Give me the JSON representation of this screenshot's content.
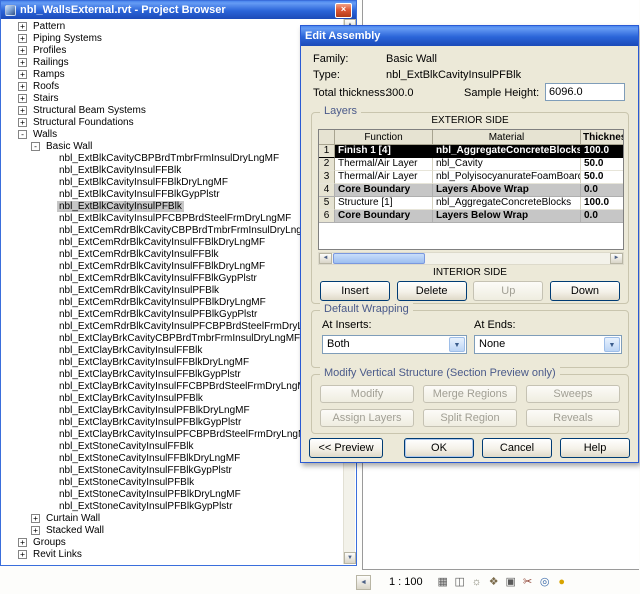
{
  "glyphs": {
    "up": "▲",
    "down": "▼",
    "left": "◄",
    "right": "►",
    "close": "×",
    "combo": "▼"
  },
  "colors": {
    "titlebar_blue": "#2A64D8",
    "dialog_bg": "#ECE9D8",
    "selected_row": "#000000",
    "core_row": "#C6C6C6",
    "tree_selection": "#C6C6C6"
  },
  "browser": {
    "title": "nbl_WallsExternal.rvt - Project Browser",
    "tree": [
      {
        "label": "Pattern",
        "level": 1,
        "exp": "+"
      },
      {
        "label": "Piping Systems",
        "level": 1,
        "exp": "+"
      },
      {
        "label": "Profiles",
        "level": 1,
        "exp": "+"
      },
      {
        "label": "Railings",
        "level": 1,
        "exp": "+"
      },
      {
        "label": "Ramps",
        "level": 1,
        "exp": "+"
      },
      {
        "label": "Roofs",
        "level": 1,
        "exp": "+"
      },
      {
        "label": "Stairs",
        "level": 1,
        "exp": "+"
      },
      {
        "label": "Structural Beam Systems",
        "level": 1,
        "exp": "+"
      },
      {
        "label": "Structural Foundations",
        "level": 1,
        "exp": "+"
      },
      {
        "label": "Walls",
        "level": 1,
        "exp": "-"
      },
      {
        "label": "Basic Wall",
        "level": 2,
        "exp": "-"
      },
      {
        "label": "nbl_ExtBlkCavityCBPBrdTmbrFrmInsulDryLngMF",
        "level": 3
      },
      {
        "label": "nbl_ExtBlkCavityInsulFFBlk",
        "level": 3
      },
      {
        "label": "nbl_ExtBlkCavityInsulFFBlkDryLngMF",
        "level": 3
      },
      {
        "label": "nbl_ExtBlkCavityInsulFFBlkGypPlstr",
        "level": 3
      },
      {
        "label": "nbl_ExtBlkCavityInsulPFBlk",
        "level": 3,
        "selected": true
      },
      {
        "label": "nbl_ExtBlkCavityInsulPFCBPBrdSteelFrmDryLngMF",
        "level": 3
      },
      {
        "label": "nbl_ExtCemRdrBlkCavityCBPBrdTmbrFrmInsulDryLngMF",
        "level": 3
      },
      {
        "label": "nbl_ExtCemRdrBlkCavityInsulFFBlkDryLngMF",
        "level": 3
      },
      {
        "label": "nbl_ExtCemRdrBlkCavityInsulFFBlk",
        "level": 3
      },
      {
        "label": "nbl_ExtCemRdrBlkCavityInsulFFBlkDryLngMF",
        "level": 3
      },
      {
        "label": "nbl_ExtCemRdrBlkCavityInsulFFBlkGypPlstr",
        "level": 3
      },
      {
        "label": "nbl_ExtCemRdrBlkCavityInsulPFBlk",
        "level": 3
      },
      {
        "label": "nbl_ExtCemRdrBlkCavityInsulPFBlkDryLngMF",
        "level": 3
      },
      {
        "label": "nbl_ExtCemRdrBlkCavityInsulPFBlkGypPlstr",
        "level": 3
      },
      {
        "label": "nbl_ExtCemRdrBlkCavityInsulPFCBPBrdSteelFrmDryLngMF",
        "level": 3
      },
      {
        "label": "nbl_ExtClayBrkCavityCBPBrdTmbrFrmInsulDryLngMF",
        "level": 3
      },
      {
        "label": "nbl_ExtClayBrkCavityInsulFFBlk",
        "level": 3
      },
      {
        "label": "nbl_ExtClayBrkCavityInsulFFBlkDryLngMF",
        "level": 3
      },
      {
        "label": "nbl_ExtClayBrkCavityInsulFFBlkGypPlstr",
        "level": 3
      },
      {
        "label": "nbl_ExtClayBrkCavityInsulFFCBPBrdSteelFrmDryLngMF",
        "level": 3
      },
      {
        "label": "nbl_ExtClayBrkCavityInsulPFBlk",
        "level": 3
      },
      {
        "label": "nbl_ExtClayBrkCavityInsulPFBlkDryLngMF",
        "level": 3
      },
      {
        "label": "nbl_ExtClayBrkCavityInsulPFBlkGypPlstr",
        "level": 3
      },
      {
        "label": "nbl_ExtClayBrkCavityInsulPFCBPBrdSteelFrmDryLngMF",
        "level": 3
      },
      {
        "label": "nbl_ExtStoneCavityInsulFFBlk",
        "level": 3
      },
      {
        "label": "nbl_ExtStoneCavityInsulFFBlkDryLngMF",
        "level": 3
      },
      {
        "label": "nbl_ExtStoneCavityInsulFFBlkGypPlstr",
        "level": 3
      },
      {
        "label": "nbl_ExtStoneCavityInsulPFBlk",
        "level": 3
      },
      {
        "label": "nbl_ExtStoneCavityInsulPFBlkDryLngMF",
        "level": 3
      },
      {
        "label": "nbl_ExtStoneCavityInsulPFBlkGypPlstr",
        "level": 3
      },
      {
        "label": "Curtain Wall",
        "level": 2,
        "exp": "+"
      },
      {
        "label": "Stacked Wall",
        "level": 2,
        "exp": "+"
      },
      {
        "label": "Groups",
        "level": 1,
        "exp": "+"
      },
      {
        "label": "Revit Links",
        "level": 1,
        "exp": "+"
      }
    ]
  },
  "dialog": {
    "title": "Edit Assembly",
    "family_label": "Family:",
    "family_value": "Basic Wall",
    "type_label": "Type:",
    "type_value": "nbl_ExtBlkCavityInsulPFBlk",
    "total_thickness_label": "Total thickness:",
    "total_thickness_value": "300.0",
    "sample_height_label": "Sample Height:",
    "sample_height_value": "6096.0",
    "layers": {
      "group_title": "Layers",
      "exterior_label": "EXTERIOR SIDE",
      "interior_label": "INTERIOR SIDE",
      "columns": [
        "",
        "Function",
        "Material",
        "Thickness"
      ],
      "rows": [
        {
          "num": "1",
          "function": "Finish 1 [4]",
          "material": "nbl_AggregateConcreteBlocks",
          "thickness": "100.0",
          "state": "selected"
        },
        {
          "num": "2",
          "function": "Thermal/Air Layer",
          "material": "nbl_Cavity",
          "thickness": "50.0",
          "state": "normal"
        },
        {
          "num": "3",
          "function": "Thermal/Air Layer",
          "material": "nbl_PolyisocyanurateFoamBoards",
          "thickness": "50.0",
          "state": "normal"
        },
        {
          "num": "4",
          "function": "Core Boundary",
          "material": "Layers Above Wrap",
          "thickness": "0.0",
          "state": "core"
        },
        {
          "num": "5",
          "function": "Structure [1]",
          "material": "nbl_AggregateConcreteBlocks",
          "thickness": "100.0",
          "state": "normal"
        },
        {
          "num": "6",
          "function": "Core Boundary",
          "material": "Layers Below Wrap",
          "thickness": "0.0",
          "state": "core"
        }
      ],
      "buttons": [
        {
          "label": "Insert",
          "enabled": true
        },
        {
          "label": "Delete",
          "enabled": true
        },
        {
          "label": "Up",
          "enabled": false
        },
        {
          "label": "Down",
          "enabled": true
        }
      ]
    },
    "default_wrapping": {
      "group_title": "Default Wrapping",
      "at_inserts_label": "At Inserts:",
      "at_inserts_value": "Both",
      "at_ends_label": "At Ends:",
      "at_ends_value": "None"
    },
    "modify_vertical": {
      "group_title": "Modify Vertical Structure (Section Preview only)",
      "buttons": [
        {
          "label": "Modify",
          "enabled": false
        },
        {
          "label": "Merge Regions",
          "enabled": false
        },
        {
          "label": "Sweeps",
          "enabled": false
        },
        {
          "label": "Assign Layers",
          "enabled": false
        },
        {
          "label": "Split Region",
          "enabled": false
        },
        {
          "label": "Reveals",
          "enabled": false
        }
      ]
    },
    "footer_buttons": [
      {
        "label": "<< Preview",
        "enabled": true,
        "name": "preview-button",
        "cls": "prev-btn spacer"
      },
      {
        "label": "OK",
        "enabled": true,
        "default": true,
        "name": "ok-button",
        "cls": "foot-btn"
      },
      {
        "label": "Cancel",
        "enabled": true,
        "name": "cancel-button",
        "cls": "foot-btn"
      },
      {
        "label": "Help",
        "enabled": true,
        "name": "help-button",
        "cls": "foot-btn"
      }
    ]
  },
  "status_bar": {
    "scale_label": "1 : 100",
    "icons": [
      {
        "name": "detail-level-icon",
        "glyph": "▦",
        "color": "#5A5A5A"
      },
      {
        "name": "model-graphics-style-icon",
        "glyph": "◫",
        "color": "#5A5A5A"
      },
      {
        "name": "shadows-icon",
        "glyph": "☼",
        "color": "#7A7A6A"
      },
      {
        "name": "rendering-dialog-icon",
        "glyph": "❖",
        "color": "#7A6A4A"
      },
      {
        "name": "crop-view-icon",
        "glyph": "▣",
        "color": "#5A5A5A"
      },
      {
        "name": "crop-region-visibility-icon",
        "glyph": "✂",
        "color": "#8A3A2A"
      },
      {
        "name": "temporary-hide-isolate-icon",
        "glyph": "◎",
        "color": "#3A6AAA"
      },
      {
        "name": "reveal-hidden-elements-icon",
        "glyph": "●",
        "color": "#D8A400"
      }
    ]
  }
}
